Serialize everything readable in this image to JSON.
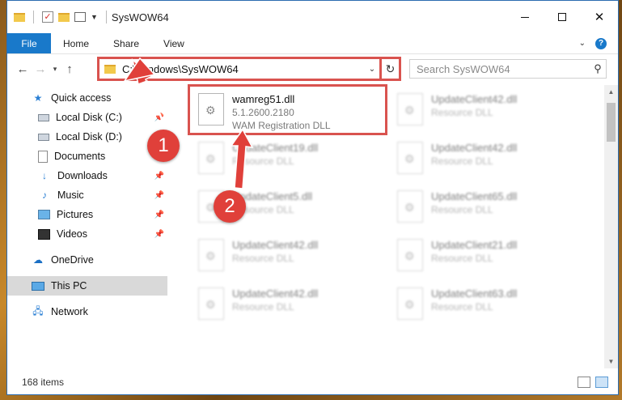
{
  "window": {
    "title": "SysWOW64",
    "quick_access_toolbar": [
      "folder-icon",
      "properties-check-icon",
      "new-folder-icon",
      "customize-dropdown"
    ]
  },
  "ribbon": {
    "tabs": [
      "File",
      "Home",
      "Share",
      "View"
    ],
    "file_tab_color": "#1979ca"
  },
  "navigation": {
    "address_path": "C:\\Windows\\SysWOW64",
    "search_placeholder": "Search SysWOW64"
  },
  "sidebar": {
    "items": [
      {
        "label": "Quick access",
        "icon": "star-icon"
      },
      {
        "label": "Local Disk (C:)",
        "icon": "disk-icon",
        "pinned": true
      },
      {
        "label": "Local Disk (D:)",
        "icon": "disk-icon"
      },
      {
        "label": "Documents",
        "icon": "document-icon"
      },
      {
        "label": "Downloads",
        "icon": "download-icon",
        "pinned": true
      },
      {
        "label": "Music",
        "icon": "music-icon",
        "pinned": true
      },
      {
        "label": "Pictures",
        "icon": "pictures-icon",
        "pinned": true
      },
      {
        "label": "Videos",
        "icon": "videos-icon",
        "pinned": true
      },
      {
        "label": "OneDrive",
        "icon": "cloud-icon"
      },
      {
        "label": "This PC",
        "icon": "computer-icon",
        "selected": true
      },
      {
        "label": "Network",
        "icon": "network-icon"
      }
    ]
  },
  "files": {
    "highlighted": {
      "name": "wamreg51.dll",
      "version": "5.1.2600.2180",
      "description": "WAM Registration DLL"
    },
    "left_column": [
      {
        "name": "UpdateClient19.dll",
        "description": "Resource DLL"
      },
      {
        "name": "UpdateClient5.dll",
        "description": "Resource DLL"
      },
      {
        "name": "UpdateClient42.dll",
        "description": "Resource DLL"
      },
      {
        "name": "UpdateClient42.dll",
        "description": "Resource DLL"
      }
    ],
    "right_column": [
      {
        "name": "UpdateClient42.dll",
        "description": "Resource DLL"
      },
      {
        "name": "UpdateClient42.dll",
        "description": "Resource DLL"
      },
      {
        "name": "UpdateClient65.dll",
        "description": "Resource DLL"
      },
      {
        "name": "UpdateClient21.dll",
        "description": "Resource DLL"
      },
      {
        "name": "UpdateClient63.dll",
        "description": "Resource DLL"
      }
    ]
  },
  "status": {
    "item_count": "168 items"
  },
  "callouts": {
    "step1": "1",
    "step2": "2",
    "color": "#e0403a"
  }
}
